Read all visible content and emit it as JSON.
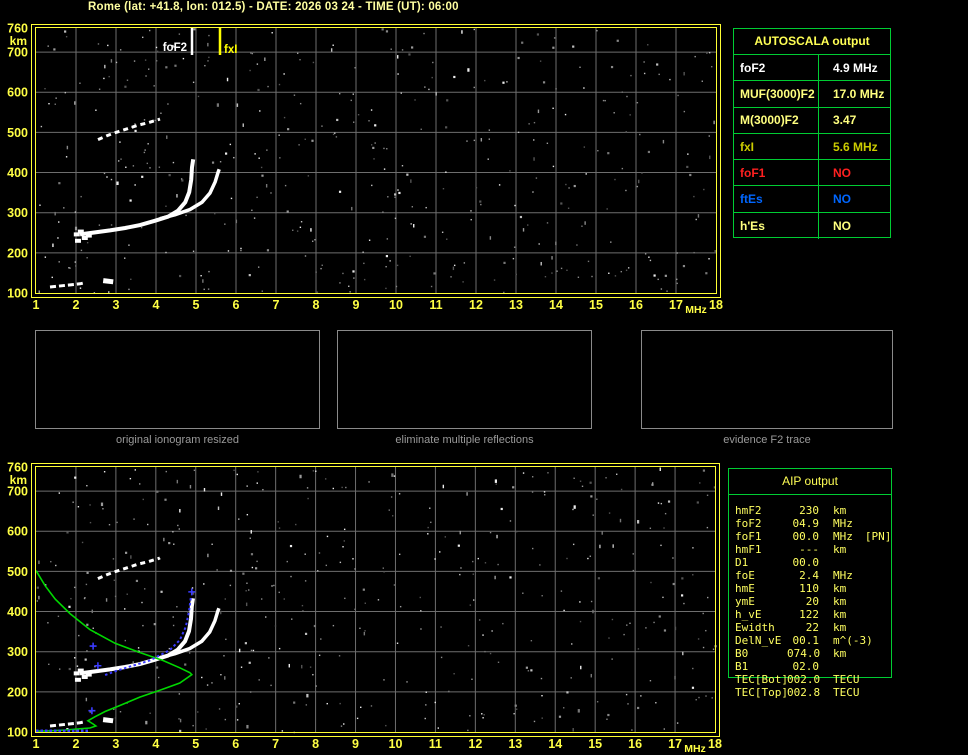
{
  "title": "Rome (lat: +41.8, lon: 012.5) - DATE: 2026 03 24 - TIME (UT): 06:00",
  "plots": {
    "x_unit": "MHz",
    "y_unit": "km",
    "x_ticks": [
      "1",
      "2",
      "3",
      "4",
      "5",
      "6",
      "7",
      "8",
      "9",
      "10",
      "11",
      "12",
      "13",
      "14",
      "15",
      "16",
      "17",
      "18"
    ],
    "y_ticks": [
      "760",
      "700",
      "600",
      "500",
      "400",
      "300",
      "200",
      "100"
    ],
    "x_range": [
      1,
      18
    ],
    "y_range": [
      100,
      760
    ],
    "markers": {
      "foF2": {
        "label": "foF2",
        "mhz": 4.9
      },
      "fxI": {
        "label": "fxI",
        "mhz": 5.6
      }
    }
  },
  "ionogram_data": {
    "o_trace": [
      [
        2.1,
        246
      ],
      [
        2.48,
        251
      ],
      [
        2.85,
        256
      ],
      [
        3.23,
        262
      ],
      [
        3.6,
        269
      ],
      [
        3.98,
        280
      ],
      [
        4.3,
        290
      ],
      [
        4.55,
        305
      ],
      [
        4.73,
        326
      ],
      [
        4.83,
        351
      ],
      [
        4.88,
        382
      ],
      [
        4.9,
        413
      ],
      [
        4.93,
        433
      ]
    ],
    "x_trace": [
      [
        4.1,
        285
      ],
      [
        4.48,
        295
      ],
      [
        4.85,
        308
      ],
      [
        5.15,
        326
      ],
      [
        5.35,
        349
      ],
      [
        5.48,
        377
      ],
      [
        5.55,
        400
      ],
      [
        5.58,
        408
      ]
    ],
    "es_trace": [
      [
        1.35,
        115
      ],
      [
        1.73,
        119
      ],
      [
        2.1,
        123
      ],
      [
        2.23,
        126
      ]
    ],
    "es_blob": [
      [
        2.68,
        131
      ],
      [
        2.93,
        128
      ]
    ],
    "spread_f_trace": [
      [
        2.55,
        482
      ],
      [
        2.78,
        492
      ],
      [
        3.0,
        500
      ],
      [
        3.25,
        508
      ],
      [
        3.55,
        518
      ],
      [
        3.8,
        524
      ],
      [
        4.1,
        533
      ]
    ],
    "cusp_blobs": [
      [
        2.02,
        246
      ],
      [
        2.12,
        253
      ],
      [
        2.22,
        237
      ],
      [
        2.32,
        243
      ],
      [
        2.05,
        230
      ]
    ],
    "profile_green": [
      [
        1.0,
        502
      ],
      [
        1.23,
        464
      ],
      [
        1.48,
        431
      ],
      [
        1.85,
        395
      ],
      [
        2.35,
        355
      ],
      [
        2.98,
        321
      ],
      [
        3.6,
        298
      ],
      [
        4.18,
        278
      ],
      [
        4.6,
        260
      ],
      [
        4.85,
        248
      ],
      [
        4.9,
        243
      ],
      [
        4.6,
        222
      ],
      [
        4.1,
        204
      ],
      [
        3.6,
        187
      ],
      [
        3.1,
        166
      ],
      [
        2.73,
        151
      ],
      [
        2.48,
        138
      ],
      [
        2.3,
        128
      ],
      [
        2.43,
        120
      ],
      [
        2.5,
        115
      ],
      [
        2.35,
        110
      ],
      [
        2.1,
        108
      ],
      [
        1.73,
        105
      ],
      [
        1.35,
        103
      ],
      [
        1.0,
        102
      ]
    ],
    "restored_blue": [
      [
        2.73,
        242
      ],
      [
        3.0,
        252
      ],
      [
        3.35,
        263
      ],
      [
        3.85,
        278
      ],
      [
        4.35,
        304
      ],
      [
        4.6,
        329
      ],
      [
        4.75,
        362
      ],
      [
        4.83,
        400
      ],
      [
        4.88,
        438
      ]
    ],
    "blue_bottom": [
      [
        1.0,
        103
      ],
      [
        2.35,
        103
      ]
    ],
    "blue_marks": [
      [
        2.43,
        314
      ],
      [
        2.55,
        265
      ],
      [
        4.9,
        449
      ],
      [
        2.4,
        153
      ]
    ]
  },
  "autoscala": {
    "title": "AUTOSCALA output",
    "rows": [
      {
        "label": "foF2",
        "value": "4.9 MHz",
        "color": "#ffffff"
      },
      {
        "label": "MUF(3000)F2",
        "value": "17.0 MHz",
        "color": "#ffff7f"
      },
      {
        "label": "M(3000)F2",
        "value": "3.47",
        "color": "#ffff7f"
      },
      {
        "label": "fxI",
        "value": "5.6 MHz",
        "color": "#cccc00"
      },
      {
        "label": "foF1",
        "value": "NO",
        "color": "#ff2020"
      },
      {
        "label": "ftEs",
        "value": "NO",
        "color": "#0066ff"
      },
      {
        "label": "h'Es",
        "value": "NO",
        "color": "#ffff7f"
      }
    ]
  },
  "aip": {
    "title": "AIP output",
    "rows": [
      {
        "label": "hmF2",
        "value": "230",
        "unit": "km",
        "note": ""
      },
      {
        "label": "foF2",
        "value": "04.9",
        "unit": "MHz",
        "note": ""
      },
      {
        "label": "foF1",
        "value": "00.0",
        "unit": "MHz",
        "note": "[PN]"
      },
      {
        "label": "hmF1",
        "value": "---",
        "unit": "km",
        "note": ""
      },
      {
        "label": "D1",
        "value": "00.0",
        "unit": "",
        "note": ""
      },
      {
        "label": "foE",
        "value": "2.4",
        "unit": "MHz",
        "note": ""
      },
      {
        "label": "hmE",
        "value": "110",
        "unit": "km",
        "note": ""
      },
      {
        "label": "ymE",
        "value": "20",
        "unit": "km",
        "note": ""
      },
      {
        "label": "h_vE",
        "value": "122",
        "unit": "km",
        "note": ""
      },
      {
        "label": "Ewidth",
        "value": "22",
        "unit": "km",
        "note": ""
      },
      {
        "label": "DelN_vE",
        "value": "00.1",
        "unit": "m^(-3)",
        "note": ""
      },
      {
        "label": "B0",
        "value": "074.0",
        "unit": "km",
        "note": ""
      },
      {
        "label": "B1",
        "value": "02.0",
        "unit": "",
        "note": ""
      },
      {
        "label": "TEC[Bot]",
        "value": "002.0",
        "unit": "TECU",
        "note": ""
      },
      {
        "label": "TEC[Top]",
        "value": "002.8",
        "unit": "TECU",
        "note": ""
      }
    ]
  },
  "thumbnails": [
    {
      "caption": "original ionogram resized"
    },
    {
      "caption": "eliminate multiple reflections"
    },
    {
      "caption": "evidence F2 trace"
    }
  ],
  "colors": {
    "title": "#ffffa0",
    "axis": "#ffff44",
    "frame": "#ffff33",
    "grid": "#6e6e6e",
    "table_border": "#00cc33",
    "profile_green": "#00d800",
    "restored_blue": "#3b3bff",
    "trace_white": "#ffffff",
    "marker_foF2": "#ffffff",
    "marker_fxI": "#ffff00",
    "caption_gray": "#9a9a9a"
  }
}
